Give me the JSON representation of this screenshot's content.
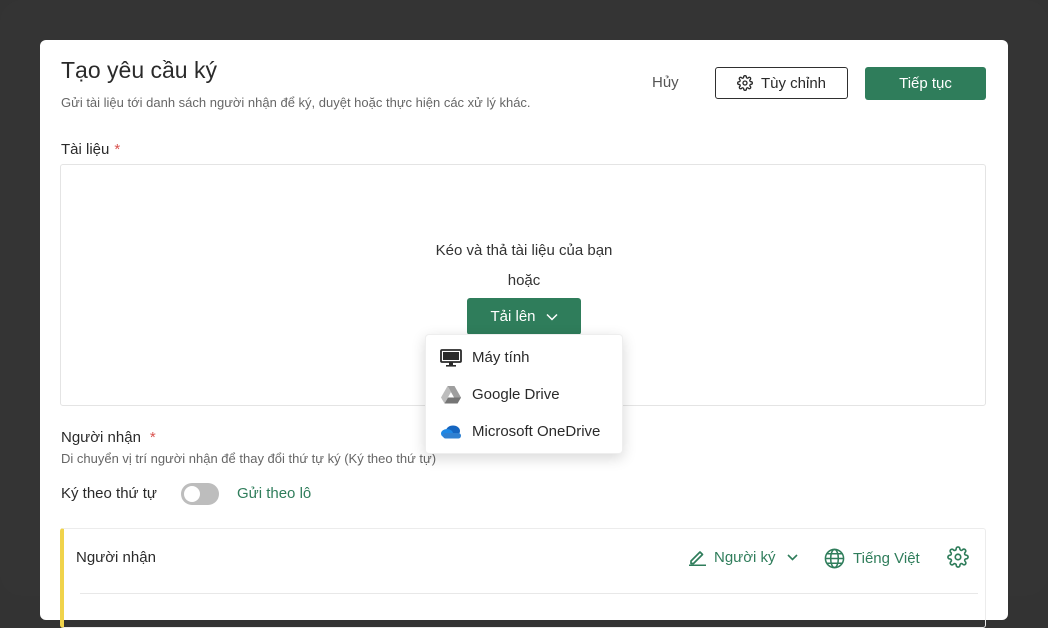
{
  "header": {
    "title": "Tạo yêu cầu ký",
    "subtitle": "Gửi tài liệu tới danh sách người nhận để ký, duyệt hoặc thực hiện các xử lý khác.",
    "cancel_label": "Hủy",
    "customize_label": "Tùy chỉnh",
    "continue_label": "Tiếp tục"
  },
  "documents": {
    "label": "Tài liệu",
    "required_mark": "*",
    "drop_text": "Kéo và thả tài liệu của bạn",
    "or_text": "hoặc",
    "upload_label": "Tải lên",
    "menu": [
      {
        "label": "Máy tính",
        "icon": "computer-icon"
      },
      {
        "label": "Google Drive",
        "icon": "google-drive-icon"
      },
      {
        "label": "Microsoft OneDrive",
        "icon": "onedrive-icon"
      }
    ]
  },
  "recipients": {
    "label": "Người nhận",
    "required_mark": "*",
    "hint": "Di chuyển vị trí người nhận để thay đổi thứ tự ký (Ký theo thứ tự)",
    "order_label": "Ký theo thứ tự",
    "order_enabled": false,
    "batch_label": "Gửi theo lô",
    "card": {
      "title": "Người nhận",
      "role_label": "Người ký",
      "language_label": "Tiếng Việt"
    }
  },
  "colors": {
    "accent": "#2f7d5b",
    "required": "#d9534f",
    "card_marker": "#f0d34b"
  }
}
